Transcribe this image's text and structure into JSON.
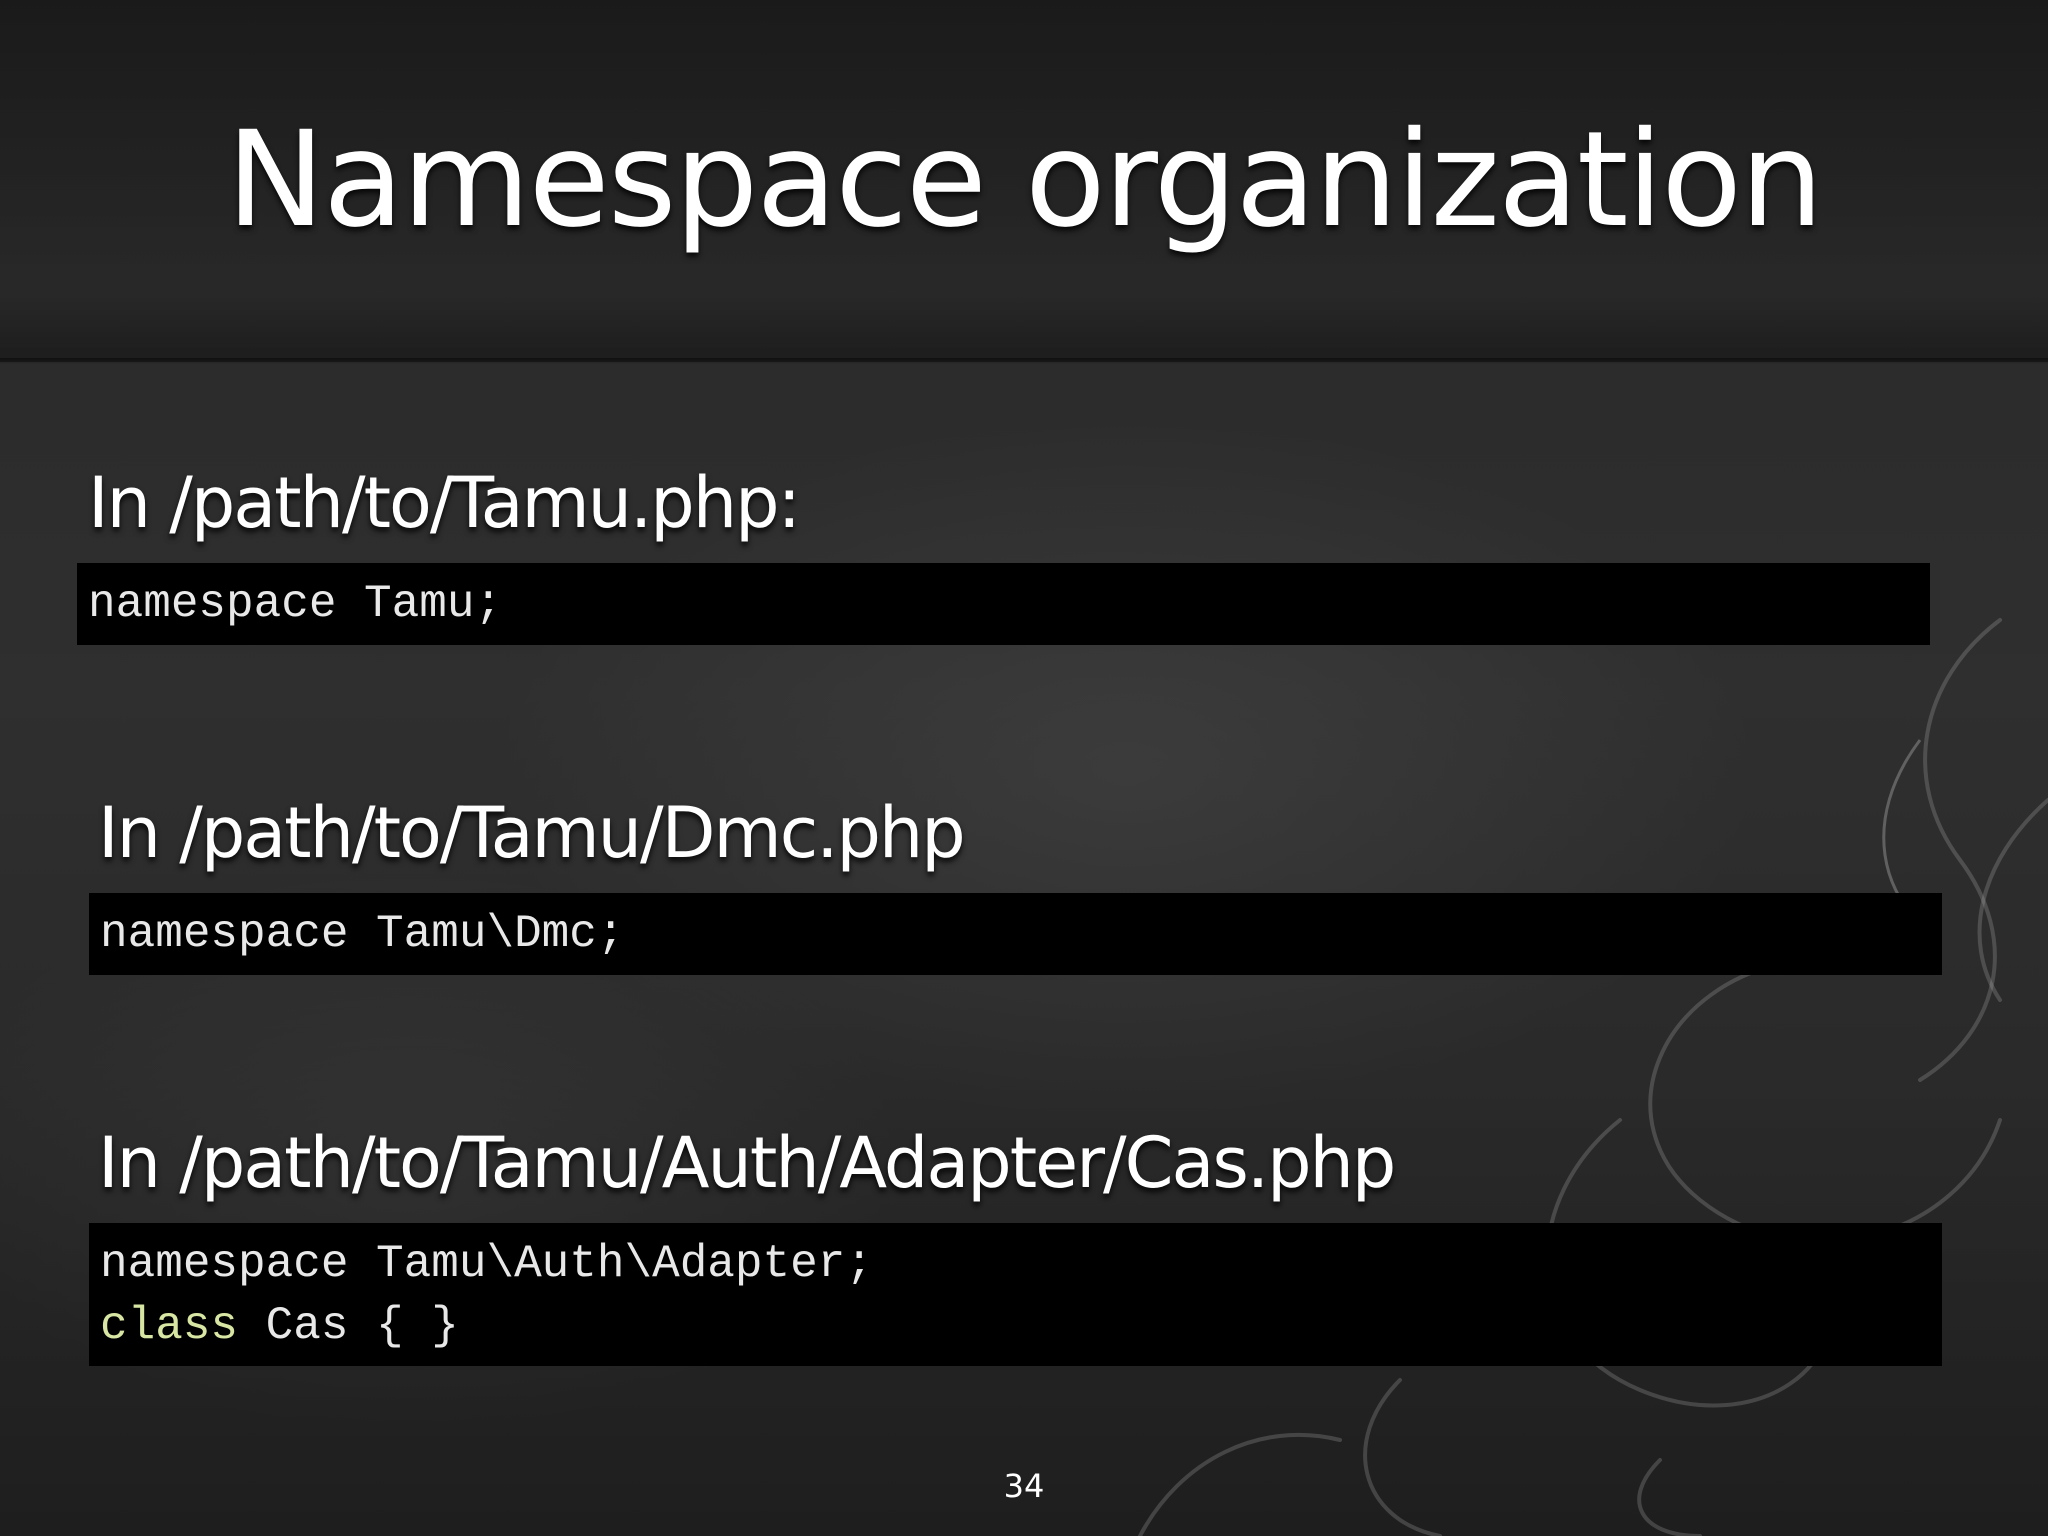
{
  "slide": {
    "title": "Namespace organization",
    "page_number": "34"
  },
  "sections": [
    {
      "label": "In /path/to/Tamu.php:",
      "code": [
        "namespace Tamu;"
      ]
    },
    {
      "label": "In /path/to/Tamu/Dmc.php",
      "code": [
        "namespace Tamu\\Dmc;"
      ]
    },
    {
      "label": "In /path/to/Tamu/Auth/Adapter/Cas.php",
      "code": [
        "namespace Tamu\\Auth\\Adapter;"
      ],
      "code_class_keyword": "class",
      "code_class_rest": " Cas { }"
    }
  ],
  "colors": {
    "background": "#2a2a2a",
    "code_background": "#000000",
    "code_text": "#e8e8e8",
    "keyword": "#d8e6a4",
    "text": "#ffffff"
  }
}
